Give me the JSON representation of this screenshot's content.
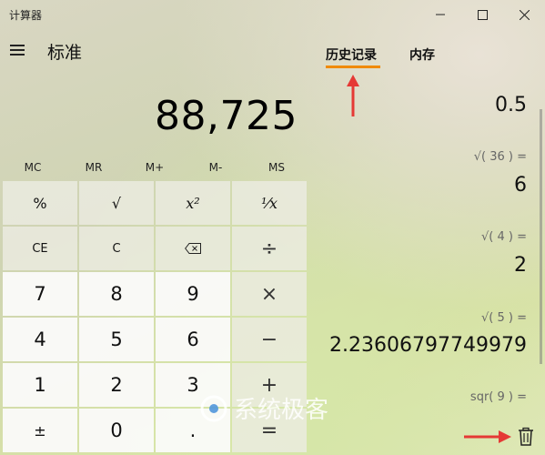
{
  "window": {
    "title": "计算器"
  },
  "header": {
    "mode_title": "标准"
  },
  "display": {
    "value": "88,725"
  },
  "memory_buttons": [
    "MC",
    "MR",
    "M+",
    "M-",
    "MS"
  ],
  "keypad": [
    [
      "%",
      "√",
      "x²",
      "¹⁄x"
    ],
    [
      "CE",
      "C",
      "⌫",
      "÷"
    ],
    [
      "7",
      "8",
      "9",
      "×"
    ],
    [
      "4",
      "5",
      "6",
      "−"
    ],
    [
      "1",
      "2",
      "3",
      "+"
    ],
    [
      "±",
      "0",
      ".",
      "="
    ]
  ],
  "tabs": {
    "history": "历史记录",
    "memory": "内存",
    "active": "history"
  },
  "history": [
    {
      "expr": "",
      "result": "0.5"
    },
    {
      "expr": "√( 36 ) =",
      "result": "6"
    },
    {
      "expr": "√( 4 ) =",
      "result": "2"
    },
    {
      "expr": "√( 5 ) =",
      "result": "2.23606797749979"
    },
    {
      "expr": "sqr( 9 ) =",
      "result": ""
    }
  ],
  "watermark": {
    "text": "系统极客"
  },
  "colors": {
    "accent": "#f08a00",
    "annotation_arrow": "#e53935"
  },
  "icons": [
    "hamburger-icon",
    "minimize-icon",
    "maximize-icon",
    "close-icon",
    "backspace-icon",
    "trash-icon"
  ]
}
